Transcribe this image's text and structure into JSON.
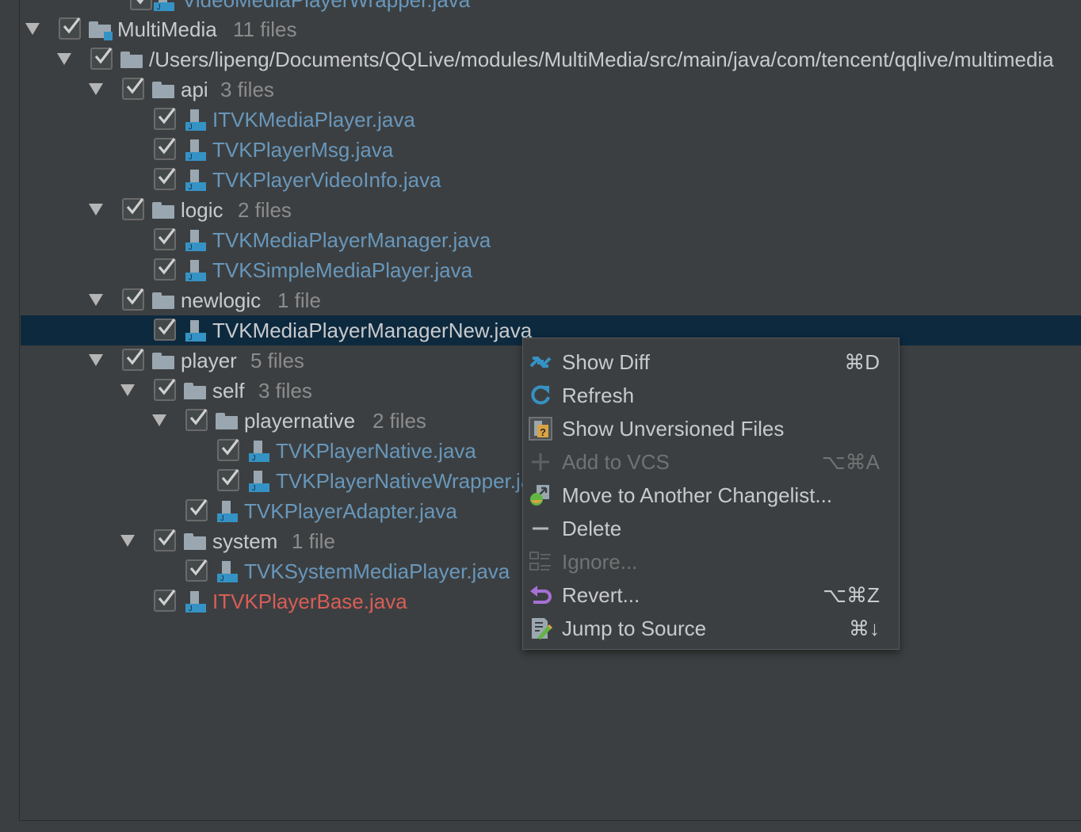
{
  "tree": {
    "partial_top": "VideoMediaPlayerWrapper.java",
    "rows": [
      {
        "name": "MultiMedia",
        "count": "11 files"
      },
      {
        "name": "/Users/lipeng/Documents/QQLive/modules/MultiMedia/src/main/java/com/tencent/qqlive/multimedia"
      },
      {
        "name": "api",
        "count": "3 files"
      },
      {
        "name": "ITVKMediaPlayer.java"
      },
      {
        "name": "TVKPlayerMsg.java"
      },
      {
        "name": "TVKPlayerVideoInfo.java"
      },
      {
        "name": "logic",
        "count": "2 files"
      },
      {
        "name": "TVKMediaPlayerManager.java"
      },
      {
        "name": "TVKSimpleMediaPlayer.java"
      },
      {
        "name": "newlogic",
        "count": "1 file"
      },
      {
        "name": "TVKMediaPlayerManagerNew.java"
      },
      {
        "name": "player",
        "count": "5 files"
      },
      {
        "name": "self",
        "count": "3 files"
      },
      {
        "name": "playernative",
        "count": "2 files"
      },
      {
        "name": "TVKPlayerNative.java"
      },
      {
        "name": "TVKPlayerNativeWrapper.java"
      },
      {
        "name": "TVKPlayerAdapter.java"
      },
      {
        "name": "system",
        "count": "1 file"
      },
      {
        "name": "TVKSystemMediaPlayer.java"
      },
      {
        "name": "ITVKPlayerBase.java"
      }
    ]
  },
  "context_menu": {
    "items": [
      {
        "label": "Show Diff",
        "shortcut": "⌘D",
        "icon": "show-diff-icon"
      },
      {
        "label": "Refresh",
        "shortcut": "",
        "icon": "refresh-icon"
      },
      {
        "label": "Show Unversioned Files",
        "shortcut": "",
        "icon": "unversioned-files-icon"
      },
      {
        "label": "Add to VCS",
        "shortcut": "⌥⌘A",
        "icon": "plus-icon",
        "disabled": true
      },
      {
        "label": "Move to Another Changelist...",
        "shortcut": "",
        "icon": "move-changelist-icon"
      },
      {
        "label": "Delete",
        "shortcut": "",
        "icon": "minus-icon"
      },
      {
        "label": "Ignore...",
        "shortcut": "",
        "icon": "ignore-icon",
        "disabled": true
      },
      {
        "label": "Revert...",
        "shortcut": "⌥⌘Z",
        "icon": "revert-icon"
      },
      {
        "label": "Jump to Source",
        "shortcut": "⌘↓",
        "icon": "jump-to-source-icon"
      }
    ]
  },
  "colors": {
    "background": "#3c3f41",
    "selection": "#0d293e",
    "modified_file": "#6897bb",
    "deleted_file": "#d85e57",
    "menu_text": "#c8cacc",
    "disabled_text": "#707273"
  }
}
